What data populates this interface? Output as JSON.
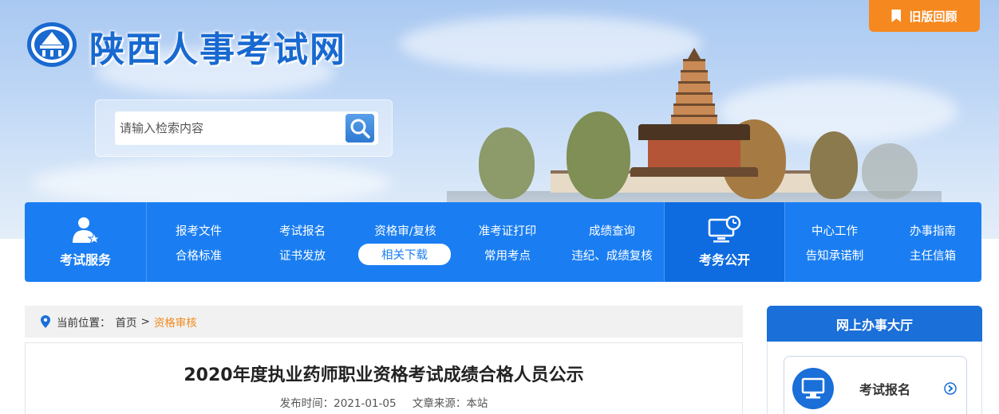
{
  "site": {
    "title": "陕西人事考试网",
    "old_version_label": "旧版回顾"
  },
  "search": {
    "placeholder": "请输入检索内容"
  },
  "nav": {
    "service_label": "考试服务",
    "public_label": "考务公开",
    "links": [
      {
        "label": "报考文件"
      },
      {
        "label": "考试报名"
      },
      {
        "label": "资格审/复核"
      },
      {
        "label": "准考证打印"
      },
      {
        "label": "成绩查询"
      },
      {
        "label": "合格标准"
      },
      {
        "label": "证书发放"
      },
      {
        "label": "相关下载",
        "active": true
      },
      {
        "label": "常用考点"
      },
      {
        "label": "违纪、成绩复核"
      }
    ],
    "right_links": [
      {
        "label": "中心工作"
      },
      {
        "label": "办事指南"
      },
      {
        "label": "告知承诺制"
      },
      {
        "label": "主任信箱"
      }
    ]
  },
  "breadcrumb": {
    "prefix": "当前位置：",
    "home": "首页",
    "separator": ">",
    "current": "资格审核"
  },
  "article": {
    "title": "2020年度执业药师职业资格考试成绩合格人员公示",
    "publish_label": "发布时间：",
    "publish_date": "2021-01-05",
    "source_label": "文章来源：",
    "source": "本站"
  },
  "sidebar": {
    "heading": "网上办事大厅",
    "items": [
      {
        "label": "考试报名",
        "icon": "monitor-icon"
      }
    ]
  },
  "colors": {
    "primary": "#1a7ef2",
    "accent": "#f5891f",
    "breadcrumb_current": "#f08a1e"
  }
}
